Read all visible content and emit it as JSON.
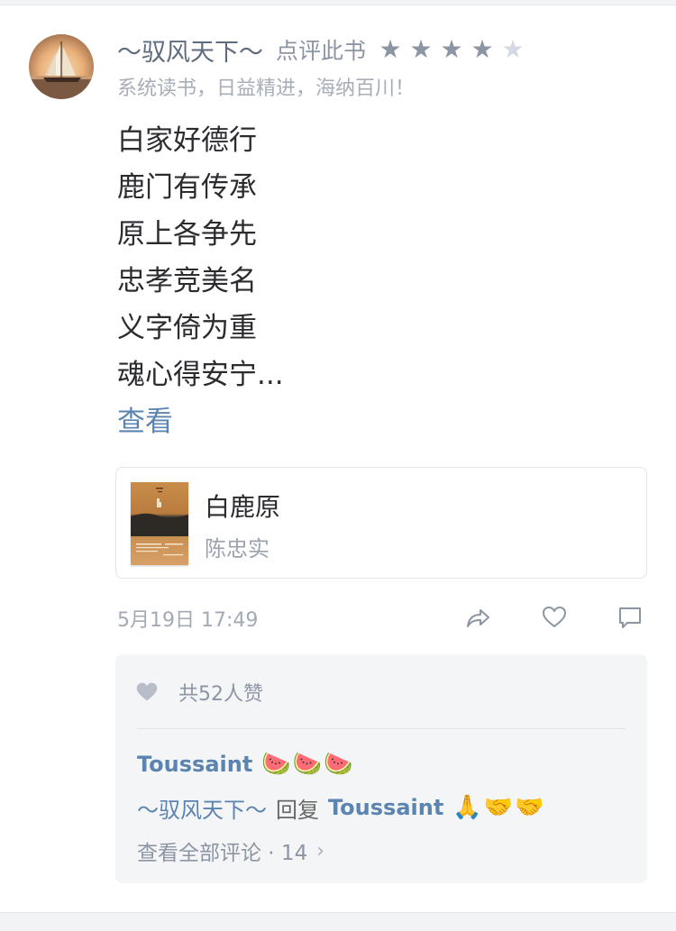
{
  "post": {
    "username": "～驭风天下～",
    "action": "点评此书",
    "rating": 4,
    "rating_max": 5,
    "signature": "系统读书，日益精进，海纳百川！",
    "review_lines": [
      "白家好德行",
      "鹿门有传承",
      "原上各争先",
      "忠孝竞美名",
      "义字倚为重",
      "魂心得安宁..."
    ],
    "more_label": "查看",
    "timestamp": "5月19日 17:49"
  },
  "book": {
    "title": "白鹿原",
    "author": "陈忠实"
  },
  "icons": {
    "share": "share-icon",
    "like": "heart-outline-icon",
    "comment": "comment-icon",
    "likes": "heart-filled-icon"
  },
  "interactions": {
    "likes_text": "共52人赞",
    "comments": [
      {
        "user": "Toussaint",
        "emoji": "🍉🍉🍉"
      },
      {
        "user": "～驭风天下～",
        "reply_word": "回复",
        "target": "Toussaint",
        "emoji": "🙏🤝🤝"
      }
    ],
    "view_all_label": "查看全部评论 · 14",
    "chevron": "›"
  },
  "colors": {
    "link": "#5b84b1",
    "muted": "#8c95a3",
    "panel": "#f4f5f7"
  }
}
